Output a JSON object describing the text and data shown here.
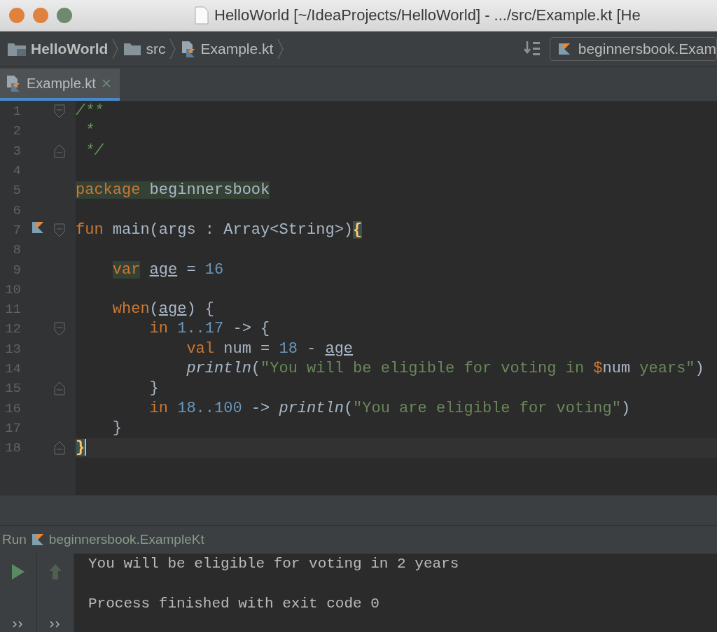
{
  "window": {
    "title": "HelloWorld [~/IdeaProjects/HelloWorld] - .../src/Example.kt [He"
  },
  "breadcrumbs": [
    {
      "label": "HelloWorld",
      "kind": "project"
    },
    {
      "label": "src",
      "kind": "folder"
    },
    {
      "label": "Example.kt",
      "kind": "file"
    }
  ],
  "run_config": {
    "label": "beginnersbook.Exam"
  },
  "tabs": [
    {
      "label": "Example.kt",
      "selected": true
    }
  ],
  "editor": {
    "lines": [
      {
        "number": "1",
        "fold": {
          "kind": "start"
        },
        "tokens": [
          {
            "text": "/**",
            "kind": "comment"
          }
        ]
      },
      {
        "number": "2",
        "indent": {
          "kind": "space"
        },
        "tokens": [
          {
            "text": "*",
            "kind": "comment"
          }
        ]
      },
      {
        "number": "3",
        "fold": {
          "kind": "end"
        },
        "indent": {
          "kind": "space"
        },
        "tokens": [
          {
            "text": "*/",
            "kind": "comment"
          }
        ]
      },
      {
        "number": "4"
      },
      {
        "number": "5",
        "tokens": [
          {
            "text": "package",
            "kind": "marked-keyword"
          },
          {
            "text": " beginnersbook",
            "kind": "marked-plain"
          }
        ]
      },
      {
        "number": "6"
      },
      {
        "number": "7",
        "fold": {
          "kind": "start"
        },
        "run_marker": true,
        "tokens": [
          {
            "text": "fun",
            "kind": "keyword"
          },
          {
            "text": " main(args : Array<String>)",
            "kind": "plain"
          },
          {
            "text": "{",
            "kind": "brace-match"
          }
        ]
      },
      {
        "number": "8"
      },
      {
        "number": "9",
        "indent": {
          "kind": "level-1"
        },
        "tokens": [
          {
            "text": "var",
            "kind": "marked-keyword"
          },
          {
            "text": "age",
            "kind": "spaced-ref"
          },
          {
            "text": " = ",
            "kind": "plain"
          },
          {
            "text": "16",
            "kind": "number"
          }
        ]
      },
      {
        "number": "10"
      },
      {
        "number": "11",
        "indent": {
          "kind": "level-1"
        },
        "tokens": [
          {
            "text": "when",
            "kind": "keyword"
          },
          {
            "text": "(",
            "kind": "plain"
          },
          {
            "text": "age",
            "kind": "ref"
          },
          {
            "text": ") {",
            "kind": "plain"
          }
        ]
      },
      {
        "number": "12",
        "fold": {
          "kind": "start"
        },
        "indent": {
          "kind": "level-2"
        },
        "tokens": [
          {
            "text": "in ",
            "kind": "keyword"
          },
          {
            "text": "1..17",
            "kind": "number"
          },
          {
            "text": " -> {",
            "kind": "plain"
          }
        ]
      },
      {
        "number": "13",
        "indent": {
          "kind": "level-3"
        },
        "tokens": [
          {
            "text": "val",
            "kind": "keyword"
          },
          {
            "text": " num = ",
            "kind": "plain"
          },
          {
            "text": "18",
            "kind": "number"
          },
          {
            "text": " - ",
            "kind": "plain"
          },
          {
            "text": "age",
            "kind": "ref"
          }
        ]
      },
      {
        "number": "14",
        "indent": {
          "kind": "level-3"
        },
        "tokens": [
          {
            "text": "println",
            "kind": "call"
          },
          {
            "text": "(",
            "kind": "plain"
          },
          {
            "text": "\"You will be eligible for voting in ",
            "kind": "string"
          },
          {
            "text": "$",
            "kind": "keyword"
          },
          {
            "text": "num",
            "kind": "plain"
          },
          {
            "text": " years\"",
            "kind": "string"
          },
          {
            "text": ")",
            "kind": "plain"
          }
        ]
      },
      {
        "number": "15",
        "fold": {
          "kind": "end"
        },
        "indent": {
          "kind": "level-2"
        },
        "tokens": [
          {
            "text": "}",
            "kind": "plain"
          }
        ]
      },
      {
        "number": "16",
        "indent": {
          "kind": "level-2"
        },
        "tokens": [
          {
            "text": "in ",
            "kind": "keyword"
          },
          {
            "text": "18..100",
            "kind": "number"
          },
          {
            "text": " -> ",
            "kind": "plain"
          },
          {
            "text": "println",
            "kind": "call"
          },
          {
            "text": "(",
            "kind": "plain"
          },
          {
            "text": "\"You are eligible for voting\"",
            "kind": "string"
          },
          {
            "text": ")",
            "kind": "plain"
          }
        ]
      },
      {
        "number": "17",
        "indent": {
          "kind": "level-1"
        },
        "tokens": [
          {
            "text": "}",
            "kind": "plain"
          }
        ]
      },
      {
        "number": "18",
        "fold": {
          "kind": "end"
        },
        "current": true,
        "tokens": [
          {
            "text": "}",
            "kind": "brace-match"
          }
        ]
      }
    ]
  },
  "run_panel": {
    "label": "Run",
    "config": "beginnersbook.ExampleKt",
    "output": [
      {
        "text": "You will be eligible for voting in 2 years",
        "kind": "program-output"
      },
      {
        "text": "Process finished with exit code 0",
        "kind": "exit-status"
      }
    ]
  }
}
